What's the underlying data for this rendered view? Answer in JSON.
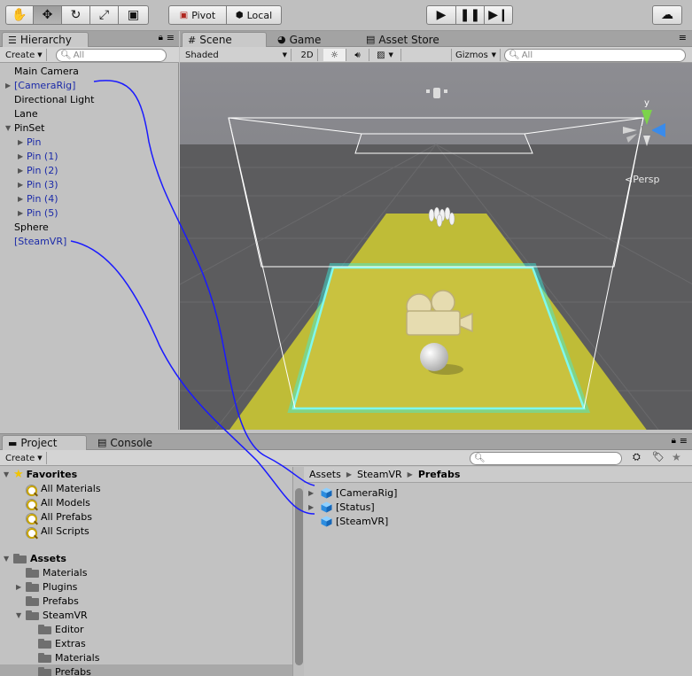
{
  "toolbar": {
    "pivot_label": "Pivot",
    "local_label": "Local"
  },
  "hierarchy": {
    "tab_label": "Hierarchy",
    "create_label": "Create",
    "search_placeholder": "All",
    "items": [
      {
        "label": "Main Camera"
      },
      {
        "label": "[CameraRig]"
      },
      {
        "label": "Directional Light"
      },
      {
        "label": "Lane"
      },
      {
        "label": "PinSet"
      },
      {
        "label": "Pin"
      },
      {
        "label": "Pin (1)"
      },
      {
        "label": "Pin (2)"
      },
      {
        "label": "Pin (3)"
      },
      {
        "label": "Pin (4)"
      },
      {
        "label": "Pin (5)"
      },
      {
        "label": "Sphere"
      },
      {
        "label": "[SteamVR]"
      }
    ]
  },
  "scene": {
    "tabs": [
      {
        "label": "Scene"
      },
      {
        "label": "Game"
      },
      {
        "label": "Asset Store"
      }
    ],
    "shading_mode": "Shaded",
    "mode_2d": "2D",
    "gizmos_label": "Gizmos",
    "search_placeholder": "All",
    "gizmo_axis": "y",
    "projection": "Persp"
  },
  "project": {
    "tabs": [
      {
        "label": "Project"
      },
      {
        "label": "Console"
      }
    ],
    "create_label": "Create",
    "favorites_label": "Favorites",
    "favorites": [
      {
        "label": "All Materials"
      },
      {
        "label": "All Models"
      },
      {
        "label": "All Prefabs"
      },
      {
        "label": "All Scripts"
      }
    ],
    "assets_label": "Assets",
    "assets": [
      {
        "label": "Materials"
      },
      {
        "label": "Plugins"
      },
      {
        "label": "Prefabs"
      },
      {
        "label": "SteamVR"
      },
      {
        "label": "Editor"
      },
      {
        "label": "Extras"
      },
      {
        "label": "Materials"
      },
      {
        "label": "Prefabs"
      }
    ],
    "breadcrumb": [
      "Assets",
      "SteamVR",
      "Prefabs"
    ],
    "files": [
      {
        "label": "[CameraRig]"
      },
      {
        "label": "[Status]"
      },
      {
        "label": "[SteamVR]"
      }
    ]
  },
  "colors": {
    "prefab_blue": "#1b2aa8",
    "annotation_stroke": "#1a1aff",
    "lane": "#c7c13f",
    "highlight": "#39f0e0"
  }
}
